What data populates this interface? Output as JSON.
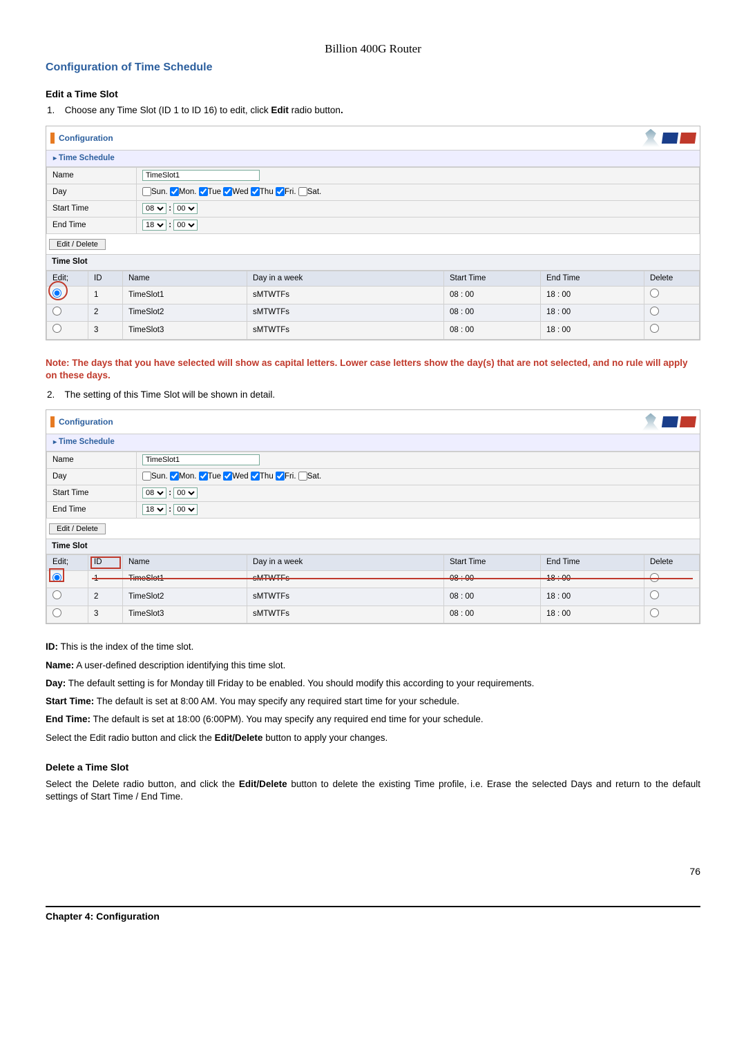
{
  "doc_title": "Billion 400G Router",
  "section_title": "Configuration of Time Schedule",
  "edit_heading": "Edit a Time Slot",
  "step1_prefix": "1.",
  "step1_a": "Choose any Time Slot (ID 1 to ID 16) to edit, click ",
  "step1_b": "Edit",
  "step1_c": " radio button",
  "step1_d": ".",
  "panel": {
    "config_label": "Configuration",
    "time_schedule": "Time Schedule",
    "labels": {
      "name": "Name",
      "day": "Day",
      "start": "Start Time",
      "end": "End Time"
    },
    "name_value": "TimeSlot1",
    "days": {
      "sun": "Sun.",
      "mon": "Mon.",
      "tue": "Tue",
      "wed": "Wed",
      "thu": "Thu",
      "fri": "Fri.",
      "sat": "Sat."
    },
    "start_hour": "08",
    "start_min": "00",
    "end_hour": "18",
    "end_min": "00",
    "edit_delete_btn": "Edit / Delete",
    "slot_caption": "Time Slot",
    "headers": {
      "edit": "Edit;",
      "id": "ID",
      "name": "Name",
      "dayweek": "Day in a week",
      "start": "Start Time",
      "end": "End Time",
      "delete": "Delete"
    },
    "rows": [
      {
        "id": "1",
        "name": "TimeSlot1",
        "day": "sMTWTFs",
        "start": "08 : 00",
        "end": "18 : 00"
      },
      {
        "id": "2",
        "name": "TimeSlot2",
        "day": "sMTWTFs",
        "start": "08 : 00",
        "end": "18 : 00"
      },
      {
        "id": "3",
        "name": "TimeSlot3",
        "day": "sMTWTFs",
        "start": "08 : 00",
        "end": "18 : 00"
      }
    ]
  },
  "note": "Note: The days that you have selected will show as capital letters. Lower case letters show the day(s) that are not selected, and no rule will apply on these days.",
  "step2_prefix": "2.",
  "step2_text": "The setting of this Time Slot will be shown in detail.",
  "defs": {
    "id": {
      "label": "ID:",
      "text": " This is the index of the time slot."
    },
    "name": {
      "label": "Name:",
      "text": " A user-defined description identifying this time slot."
    },
    "day": {
      "label": "Day:",
      "text": " The default setting is for Monday till Friday to be enabled. You should modify this according to your requirements."
    },
    "start": {
      "label": "Start Time:",
      "text": " The default is set at 8:00 AM. You may specify any required start time for your schedule."
    },
    "end": {
      "label": "End Time:",
      "text": " The default is set at 18:00 (6:00PM). You may specify any required end time for your schedule."
    },
    "select_a": "Select the Edit radio button and click the ",
    "select_b": "Edit/Delete",
    "select_c": " button to apply your changes."
  },
  "delete_heading": "Delete a Time Slot",
  "delete_a": "Select the Delete radio button, and click the ",
  "delete_b": "Edit/Delete",
  "delete_c": " button to delete the existing Time profile, i.e. Erase the selected Days and return to the default settings of Start Time / End Time.",
  "footer_chapter": "Chapter 4: Configuration",
  "footer_page": "76",
  "colon": ":"
}
